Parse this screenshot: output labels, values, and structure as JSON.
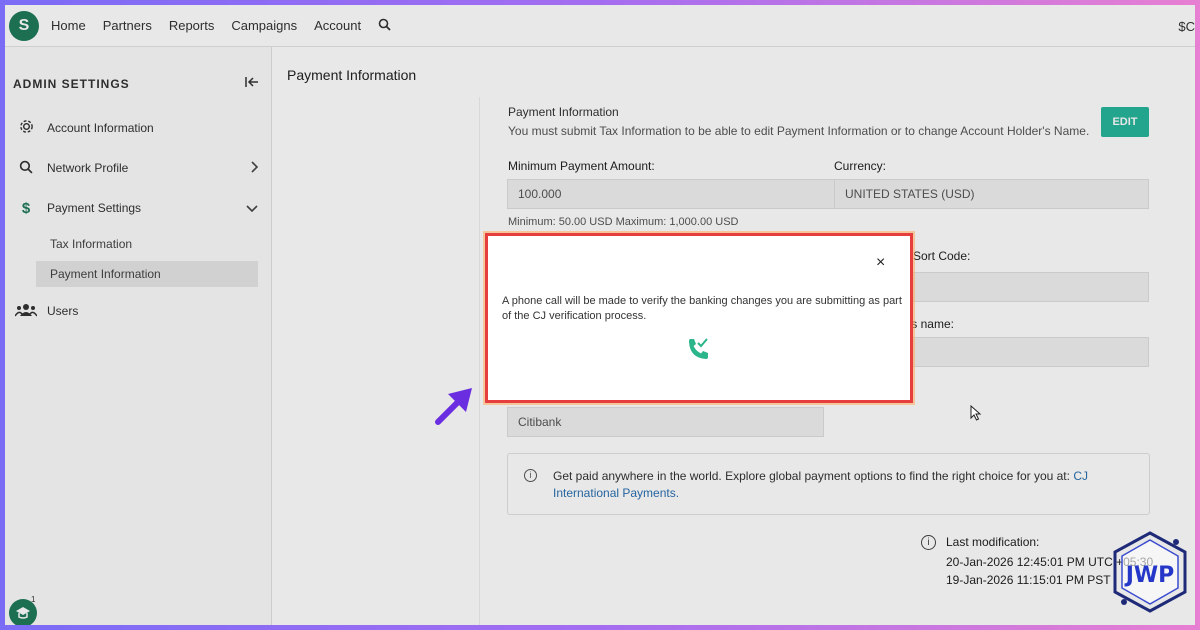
{
  "topnav": {
    "logo_glyph": "S",
    "items": [
      "Home",
      "Partners",
      "Reports",
      "Campaigns",
      "Account"
    ],
    "search_icon": "search-icon",
    "right_text": "$C"
  },
  "sidebar": {
    "header": "ADMIN SETTINGS",
    "items": [
      {
        "label": "Account Information",
        "icon": "gear-icon"
      },
      {
        "label": "Network Profile",
        "icon": "search-icon"
      },
      {
        "label": "Payment Settings",
        "icon": "dollar-icon"
      },
      {
        "label": "Users",
        "icon": "users-icon"
      }
    ],
    "sub_items": [
      "Tax Information",
      "Payment Information"
    ],
    "help_badge": "1"
  },
  "main": {
    "page_title": "Payment Information",
    "card_title": "Payment Information",
    "card_subtitle": "You must submit Tax Information to be able to edit Payment Information or to change Account Holder's Name.",
    "edit_label": "EDIT",
    "min_payment_label": "Minimum Payment Amount:",
    "min_payment_value": "100.000",
    "min_payment_hint": "Minimum: 50.00 USD Maximum: 1,000.00 USD",
    "currency_label": "Currency:",
    "currency_value": "UNITED STATES (USD)",
    "sort_code_label": "er/Sort Code:",
    "holder_name_label": "r's name:",
    "bank_value": "Citibank",
    "info_text": "Get paid anywhere in the world. Explore global payment options to find the right choice for you at:",
    "info_link_1": "CJ",
    "info_link_2": "International Payments.",
    "last_mod_label": "Last modification:",
    "last_mod_utc": "20-Jan-2026 12:45:01 PM UTC +05:30",
    "last_mod_pst": "19-Jan-2026 11:15:01 PM PST"
  },
  "modal": {
    "close_icon": "×",
    "text": "A phone call will be made to verify the banking changes you are submitting as part of the CJ verification process.",
    "icon": "phone-check-icon",
    "border_color": "#e63e3e",
    "icon_color": "#2bb58a"
  },
  "watermark": {
    "text": "JWP"
  }
}
